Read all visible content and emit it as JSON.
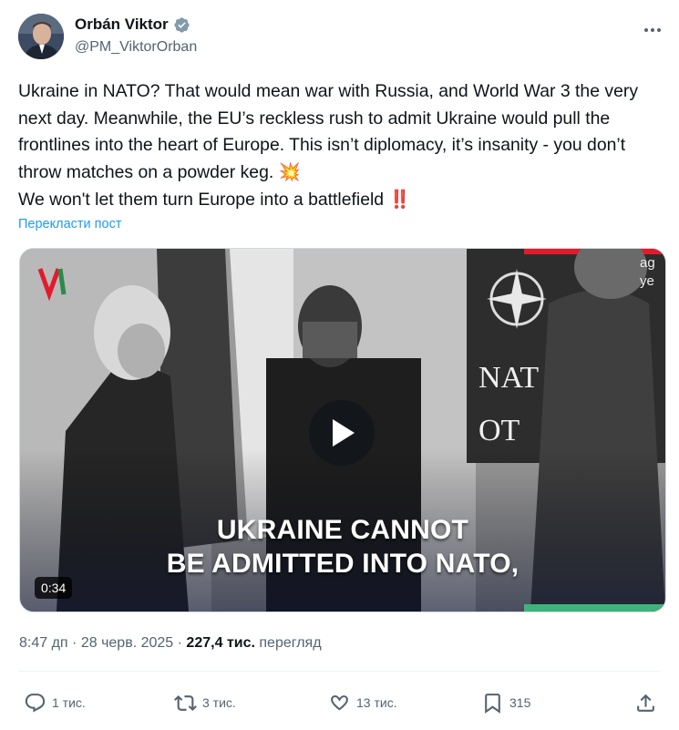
{
  "author": {
    "name": "Orbán Viktor",
    "handle": "@PM_ViktorOrban",
    "verified": true,
    "avatar": "avatar-photo"
  },
  "tweet": {
    "text": "Ukraine in NATO? That would mean war with Russia, and World War 3 the very next day. Meanwhile, the EU’s reckless rush to admit Ukraine would pull the frontlines into the heart of Europe. This isn’t diplomacy, it’s insanity - you don’t throw matches on a powder keg. 💥\nWe won't let them turn Europe into a battlefield ‼️",
    "translate_label": "Перекласти пост"
  },
  "media": {
    "type": "video",
    "duration": "0:34",
    "caption_line1": "UKRAINE CANNOT",
    "caption_line2": "BE ADMITTED INTO NATO,",
    "background_text_1": "NAT",
    "background_text_2": "OT",
    "corner_text_1": "ag",
    "corner_text_2": "ye"
  },
  "meta": {
    "time": "8:47 дп",
    "date": "28 черв. 2025",
    "views": "227,4 тис.",
    "views_label": "перегляд",
    "separator": "·"
  },
  "actions": {
    "replies": "1 тис.",
    "reposts": "3 тис.",
    "likes": "13 тис.",
    "bookmarks": "315"
  },
  "colors": {
    "link": "#1d9bf0",
    "secondary_text": "#536471",
    "verified": "#829aab"
  },
  "icons": [
    "more-icon",
    "verified-icon",
    "play-icon",
    "reply-icon",
    "repost-icon",
    "like-icon",
    "bookmark-icon",
    "share-icon"
  ]
}
